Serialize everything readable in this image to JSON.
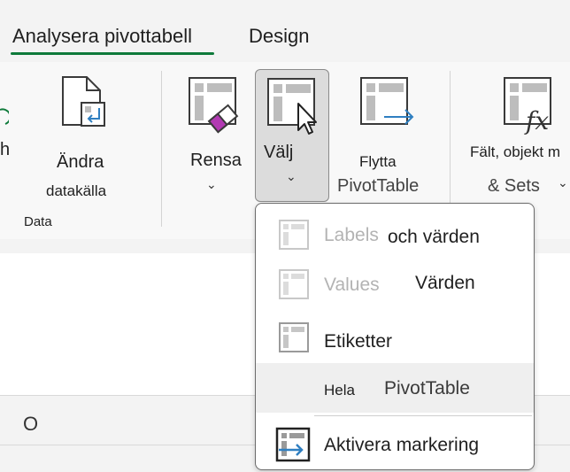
{
  "tabs": [
    {
      "label": "Analysera pivottabell"
    },
    {
      "label": "Design"
    }
  ],
  "ribbon": {
    "partial_left": "h",
    "change_source": {
      "line1": "Ändra",
      "line2": "datakälla"
    },
    "group_data": "Data",
    "clear": "Rensa",
    "select": "Välj",
    "move": {
      "line1": "Flytta",
      "line2": "PivotTable"
    },
    "fields": {
      "line1": "Fält, objekt m",
      "line2": "& Sets"
    }
  },
  "sheet": {
    "column_header": "O"
  },
  "menu": {
    "items": [
      {
        "ghost": "Labels",
        "label": "och värden",
        "icon": "pivot-layout-icon"
      },
      {
        "ghost": "Values",
        "label": "Värden",
        "icon": "pivot-layout-icon"
      },
      {
        "label": "Etiketter",
        "icon": "pivot-layout-icon"
      },
      {
        "label_a": "Hela",
        "label_b": "PivotTable"
      },
      {
        "label": "Aktivera markering",
        "icon": "enable-selection-icon"
      }
    ]
  },
  "colors": {
    "accent": "#0e7a3a",
    "icon_blue": "#2f7fc1",
    "icon_magenta": "#b23ab3"
  }
}
